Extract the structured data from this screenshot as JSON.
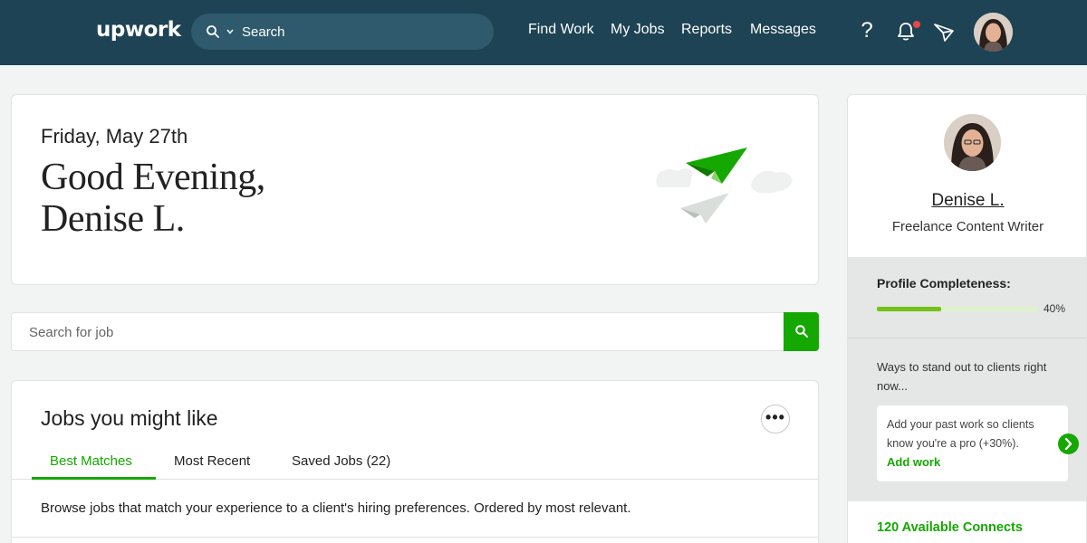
{
  "header": {
    "logo": "upwork",
    "search_placeholder": "Search",
    "nav": [
      "Find Work",
      "My Jobs",
      "Reports",
      "Messages"
    ],
    "help_glyph": "?",
    "icons": [
      "search-icon",
      "chevron-down-icon",
      "help-icon",
      "bell-icon",
      "send-icon",
      "avatar"
    ],
    "notification_dot_color": "#e44848",
    "bar_color": "#1d4354"
  },
  "greeting": {
    "date": "Friday, May 27th",
    "line1": "Good Evening,",
    "line2": "Denise L."
  },
  "job_search": {
    "placeholder": "Search for job"
  },
  "jobs": {
    "title": "Jobs you might like",
    "more_glyph": "•••",
    "tabs": [
      "Best Matches",
      "Most Recent",
      "Saved Jobs (22)"
    ],
    "active_tab": "Best Matches",
    "description": "Browse jobs that match your experience to a client's hiring preferences. Ordered by most relevant."
  },
  "profile": {
    "name": "Denise L.",
    "title": "Freelance Content Writer",
    "completeness_label": "Profile Completeness:",
    "completeness_value": "40%",
    "completeness_fraction": 0.4,
    "ways_text": "Ways to stand out to clients right now...",
    "tip_text": "Add your past work so clients know you're a pro (+30%).",
    "tip_link": "Add work",
    "connects": "120 Available Connects"
  },
  "colors": {
    "accent": "#14a800",
    "progress": "#73c218"
  }
}
